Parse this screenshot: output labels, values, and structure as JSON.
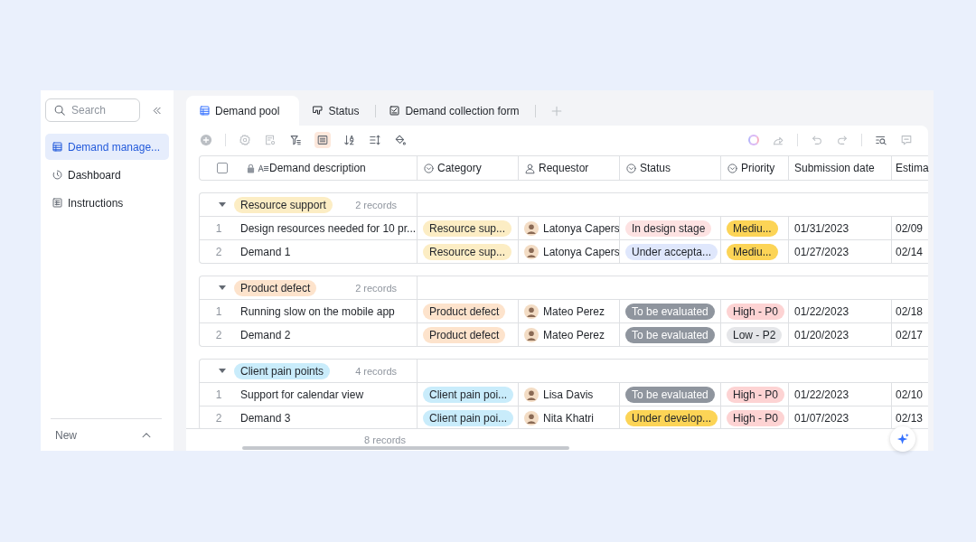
{
  "sidebar": {
    "search": {
      "placeholder": "Search"
    },
    "items": [
      {
        "label": "Demand manage...",
        "selected": true
      },
      {
        "label": "Dashboard",
        "selected": false
      },
      {
        "label": "Instructions",
        "selected": false
      }
    ],
    "footer": {
      "label": "New"
    }
  },
  "tabs": [
    {
      "label": "Demand pool",
      "selected": true
    },
    {
      "label": "Status",
      "selected": false
    },
    {
      "label": "Demand collection form",
      "selected": false
    }
  ],
  "table": {
    "select_all": {
      "checked": false
    },
    "columns": [
      {
        "label": "Demand description",
        "kind": "text",
        "locked": true
      },
      {
        "label": "Category",
        "kind": "select",
        "locked": false
      },
      {
        "label": "Requestor",
        "kind": "person",
        "locked": false
      },
      {
        "label": "Status",
        "kind": "select",
        "locked": false
      },
      {
        "label": "Priority",
        "kind": "select",
        "locked": false
      },
      {
        "label": "Submission date",
        "kind": "date",
        "locked": false
      },
      {
        "label": "Estima",
        "kind": "date",
        "locked": false
      }
    ],
    "groups": [
      {
        "label": "Resource support",
        "color": "#fcedc4",
        "count": "2 records",
        "expanded": true,
        "rows": [
          {
            "index": "1",
            "description": "Design resources needed for 10 pr...",
            "category": {
              "label": "Resource sup...",
              "color": "#fcedc4"
            },
            "requestor": "Latonya Capers",
            "status": {
              "label": "In design stage",
              "color": "#fde2e2"
            },
            "priority": {
              "label": "Mediu...",
              "color": "#fcd456"
            },
            "submitted": "01/31/2023",
            "estimated": "02/09"
          },
          {
            "index": "2",
            "description": "Demand 1",
            "category": {
              "label": "Resource sup...",
              "color": "#fcedc4"
            },
            "requestor": "Latonya Capers",
            "status": {
              "label": "Under accepta...",
              "color": "#dfe7fc"
            },
            "priority": {
              "label": "Mediu...",
              "color": "#fcd456"
            },
            "submitted": "01/27/2023",
            "estimated": "02/14"
          }
        ]
      },
      {
        "label": "Product defect",
        "color": "#fde3cc",
        "count": "2 records",
        "expanded": true,
        "rows": [
          {
            "index": "1",
            "description": "Running slow on the mobile app",
            "category": {
              "label": "Product defect",
              "color": "#fde3cc"
            },
            "requestor": "Mateo Perez",
            "status": {
              "label": "To be evaluated",
              "color": "#8f959e"
            },
            "priority": {
              "label": "High - P0",
              "color": "#fdd3d3"
            },
            "submitted": "01/22/2023",
            "estimated": "02/18"
          },
          {
            "index": "2",
            "description": "Demand 2",
            "category": {
              "label": "Product defect",
              "color": "#fde3cc"
            },
            "requestor": "Mateo Perez",
            "status": {
              "label": "To be evaluated",
              "color": "#8f959e"
            },
            "priority": {
              "label": "Low - P2",
              "color": "#e5e6e9"
            },
            "submitted": "01/20/2023",
            "estimated": "02/17"
          }
        ]
      },
      {
        "label": "Client pain points",
        "color": "#c9ecfb",
        "count": "4 records",
        "expanded": true,
        "rows": [
          {
            "index": "1",
            "description": "Support for calendar view",
            "category": {
              "label": "Client pain poi...",
              "color": "#c9ecfb"
            },
            "requestor": "Lisa Davis",
            "status": {
              "label": "To be evaluated",
              "color": "#8f959e"
            },
            "priority": {
              "label": "High - P0",
              "color": "#fdd3d3"
            },
            "submitted": "01/22/2023",
            "estimated": "02/10"
          },
          {
            "index": "2",
            "description": "Demand 3",
            "category": {
              "label": "Client pain poi...",
              "color": "#c9ecfb"
            },
            "requestor": "Nita Khatri",
            "status": {
              "label": "Under develop...",
              "color": "#fcd456"
            },
            "priority": {
              "label": "High - P0",
              "color": "#fdd3d3"
            },
            "submitted": "01/07/2023",
            "estimated": "02/13"
          }
        ]
      }
    ],
    "footer": {
      "count": "8 records"
    }
  }
}
